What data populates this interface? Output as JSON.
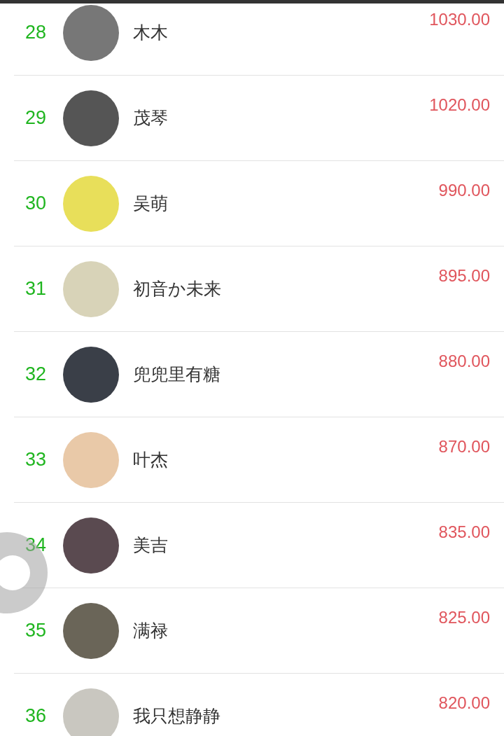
{
  "ranking": [
    {
      "rank": "28",
      "name": "木木",
      "amount": "1030.00"
    },
    {
      "rank": "29",
      "name": "茂琴",
      "amount": "1020.00"
    },
    {
      "rank": "30",
      "name": "吴萌",
      "amount": "990.00"
    },
    {
      "rank": "31",
      "name": "初音か未来",
      "amount": "895.00"
    },
    {
      "rank": "32",
      "name": "兜兜里有糖",
      "amount": "880.00"
    },
    {
      "rank": "33",
      "name": "叶杰",
      "amount": "870.00"
    },
    {
      "rank": "34",
      "name": "美吉",
      "amount": "835.00"
    },
    {
      "rank": "35",
      "name": "满禄",
      "amount": "825.00"
    },
    {
      "rank": "36",
      "name": "我只想静静",
      "amount": "820.00"
    }
  ]
}
